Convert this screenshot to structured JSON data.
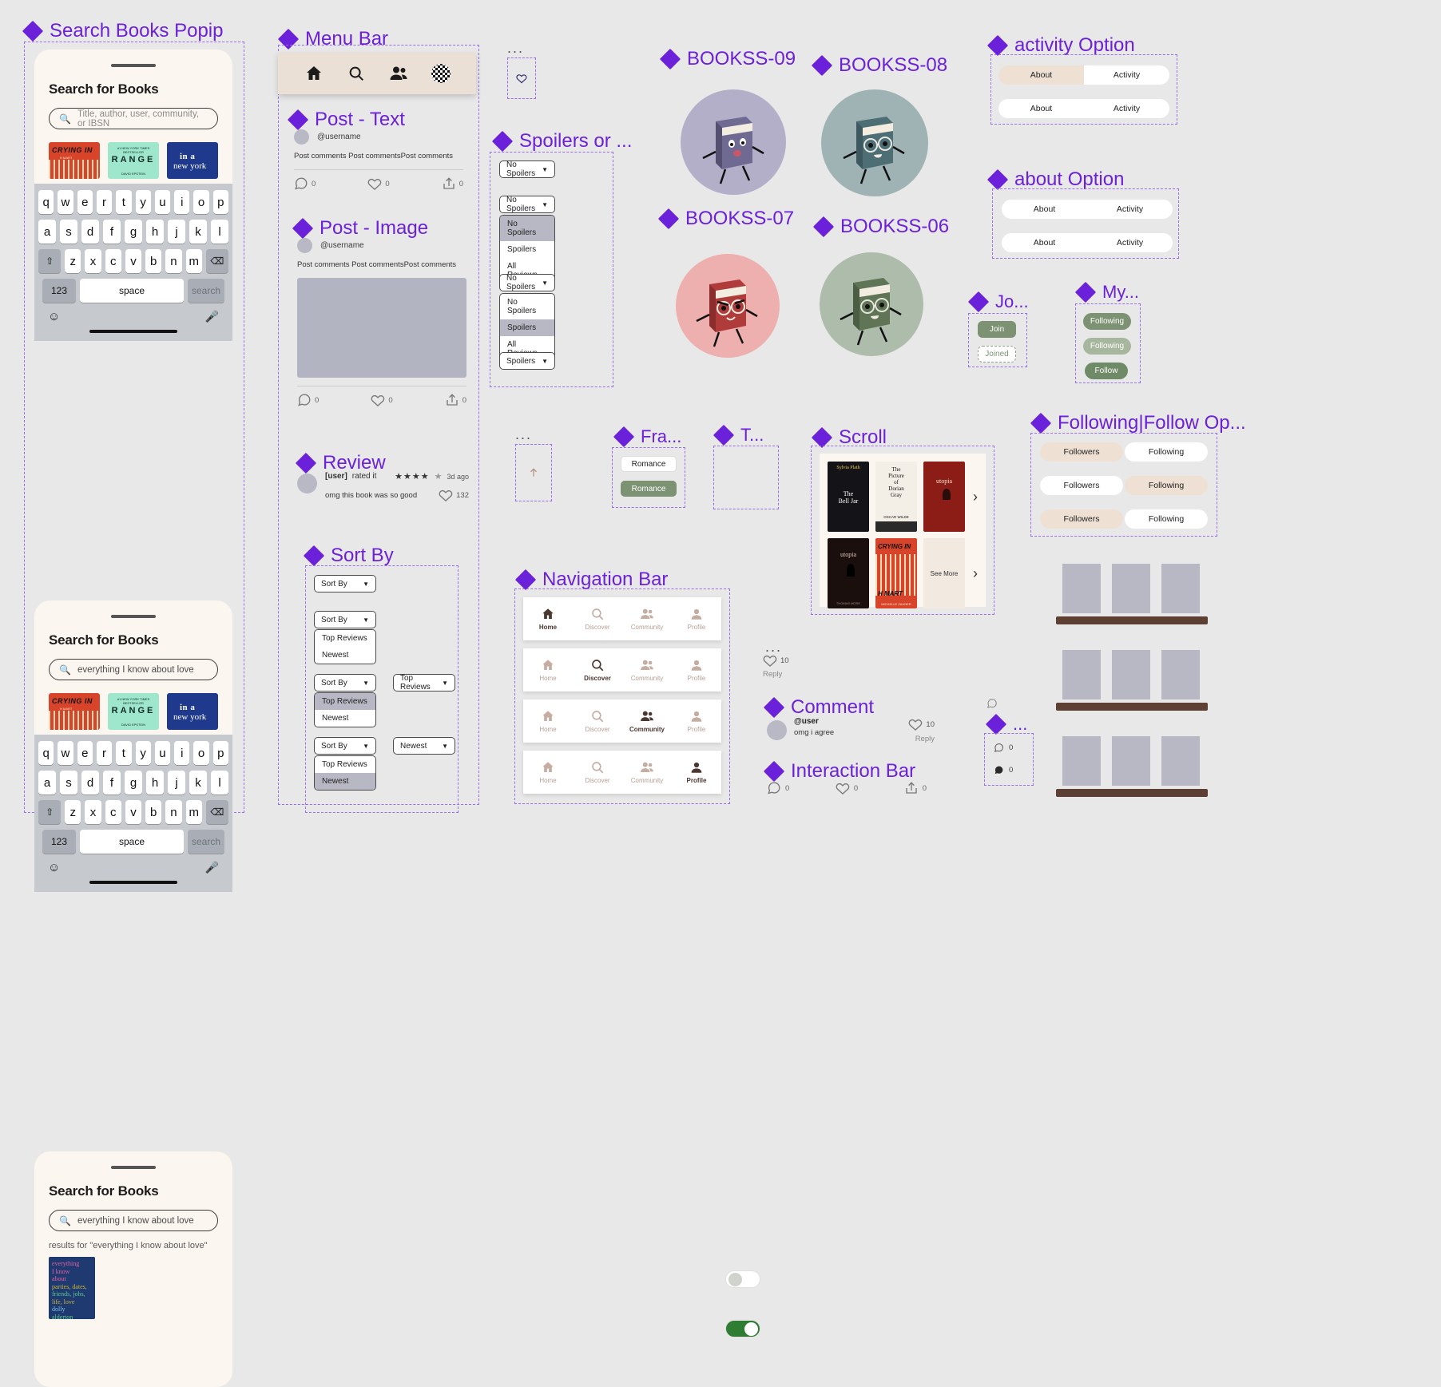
{
  "sections": {
    "search_books_popup": "Search Books Popip",
    "menu_bar": "Menu Bar",
    "post_text": "Post - Text",
    "post_image": "Post - Image",
    "spoilers": "Spoilers or ...",
    "review": "Review",
    "sort_by": "Sort By",
    "navigation_bar": "Navigation Bar",
    "bookss09": "BOOKSS-09",
    "bookss08": "BOOKSS-08",
    "bookss07": "BOOKSS-07",
    "bookss06": "BOOKSS-06",
    "activity_option": "activity Option",
    "about_option": "about Option",
    "join": "Jo...",
    "my": "My...",
    "scroll": "Scroll",
    "following_follow": "Following|Follow Op...",
    "fra": "Fra...",
    "toggle": "T...",
    "comment": "Comment",
    "interaction_bar": "Interaction Bar",
    "ellipsis": "..."
  },
  "search_popup": {
    "title": "Search for Books",
    "placeholder": "Title, author, user, community, or IBSN",
    "query": "everything I know about love",
    "results_note": "results for \"everything I know about love\"",
    "covers": [
      {
        "title": "CRYING IN",
        "sub": "H MART",
        "style": "cv-crying"
      },
      {
        "title": "RANGE",
        "top": "NEW YORK TIMES BESTSELLER",
        "bottom": "DAVID EPSTEIN",
        "style": "cv-range"
      },
      {
        "title": "in a",
        "title2": "new york",
        "style": "cv-ny"
      }
    ],
    "result_cover": [
      "everything",
      "I know",
      "about",
      "parties, dates,",
      "friends, jobs,",
      "life, love",
      "dolly",
      "alderton"
    ],
    "keyboard": {
      "row1": [
        "q",
        "w",
        "e",
        "r",
        "t",
        "y",
        "u",
        "i",
        "o",
        "p"
      ],
      "row2": [
        "a",
        "s",
        "d",
        "f",
        "g",
        "h",
        "j",
        "k",
        "l"
      ],
      "row3": [
        "z",
        "x",
        "c",
        "v",
        "b",
        "n",
        "m"
      ],
      "num": "123",
      "space": "space",
      "search": "search"
    }
  },
  "menu_bar_icons": [
    "home-icon",
    "search-icon",
    "community-icon",
    "profile-avatar-icon"
  ],
  "post": {
    "username": "@username",
    "text": "Post comments Post commentsPost comments",
    "comment_count": "0",
    "like_count": "0",
    "share_count": "0"
  },
  "spoilers": {
    "closed_label": "No Spoilers",
    "options": [
      "No Spoilers",
      "Spoilers",
      "All Reviews"
    ],
    "selected_1": "No Spoilers",
    "selected_2": "Spoilers",
    "final_label": "Spoilers"
  },
  "review": {
    "user": "[user]",
    "rated": "rated it",
    "stars": "★★★★",
    "half_star": "★",
    "time": "3d ago",
    "body": "omg this book was so good",
    "likes": "132"
  },
  "sort_by": {
    "label": "Sort By",
    "options": [
      "Top Reviews",
      "Newest"
    ],
    "closed_top": "Top Reviews",
    "closed_newest": "Newest",
    "selected_top": "Top Reviews",
    "selected_newest": "Newest"
  },
  "nav_bar": {
    "items": [
      "Home",
      "Discover",
      "Community",
      "Profile"
    ],
    "active_states": [
      0,
      1,
      2,
      3
    ]
  },
  "activity_option": {
    "tabs": [
      "About",
      "Activity"
    ],
    "row1_active": "Activity",
    "row2_active": "About"
  },
  "about_option": {
    "tabs": [
      "About",
      "Activity"
    ],
    "row1_active": "About",
    "row2_active": "Activity"
  },
  "join": {
    "join_label": "Join",
    "joined_label": "Joined"
  },
  "my_profile": {
    "following": "Following",
    "following_disabled": "Following",
    "follow": "Follow"
  },
  "following_follow": {
    "tabs": [
      "Followers",
      "Following"
    ],
    "row1_active": "Followers",
    "row2_active": "Following",
    "row3_active": "Followers"
  },
  "franchise": {
    "label": "Romance",
    "label_selected": "Romance"
  },
  "scroll": {
    "books_row1": [
      "The Bell Jar",
      "The Picture of Dorian Gray",
      "utopia"
    ],
    "books_row2": [
      "utopia",
      "CRYING IN H MART",
      "See More"
    ],
    "see_more": "See More",
    "chevron": "›"
  },
  "comment": {
    "user": "@user",
    "body": "omg i agree",
    "likes": "10",
    "reply": "Reply"
  },
  "reply_standalone": {
    "likes": "10",
    "reply": "Reply"
  },
  "interaction_bar": {
    "comments": "0",
    "likes": "0",
    "shares": "0"
  },
  "comment_counts": {
    "outline": "0",
    "filled": "0"
  },
  "colors": {
    "accent": "#6b21d9",
    "canvas": "#e8e8e8",
    "cream": "#fcf6f0",
    "beige": "#eee1d3",
    "green": "#7d9272",
    "toggle_on": "#2e7d32"
  }
}
